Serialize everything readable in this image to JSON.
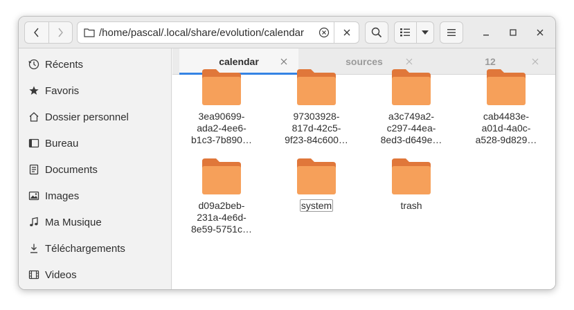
{
  "path": "/home/pascal/.local/share/evolution/calendar",
  "sidebar": {
    "items": [
      {
        "label": "Récents",
        "icon": "clock-icon"
      },
      {
        "label": "Favoris",
        "icon": "star-icon"
      },
      {
        "label": "Dossier personnel",
        "icon": "home-icon"
      },
      {
        "label": "Bureau",
        "icon": "desktop-icon"
      },
      {
        "label": "Documents",
        "icon": "document-icon"
      },
      {
        "label": "Images",
        "icon": "image-icon"
      },
      {
        "label": "Ma Musique",
        "icon": "music-icon"
      },
      {
        "label": "Téléchargements",
        "icon": "download-icon"
      },
      {
        "label": "Videos",
        "icon": "video-icon"
      }
    ]
  },
  "tabs": [
    {
      "label": "calendar",
      "active": true
    },
    {
      "label": "sources",
      "active": false
    },
    {
      "label": "12",
      "active": false
    }
  ],
  "files": [
    {
      "name_lines": [
        "3ea90699-",
        "ada2-4ee6-",
        "b1c3-7b890…"
      ]
    },
    {
      "name_lines": [
        "97303928-",
        "817d-42c5-",
        "9f23-84c600…"
      ]
    },
    {
      "name_lines": [
        "a3c749a2-",
        "c297-44ea-",
        "8ed3-d649e…"
      ]
    },
    {
      "name_lines": [
        "cab4483e-",
        "a01d-4a0c-",
        "a528-9d829…"
      ]
    },
    {
      "name_lines": [
        "d09a2beb-",
        "231a-4e6d-",
        "8e59-5751c…"
      ]
    },
    {
      "name_lines": [
        "system"
      ]
    },
    {
      "name_lines": [
        "trash"
      ]
    }
  ],
  "colors": {
    "folder_body": "#f6a05a",
    "folder_tab": "#e0773a",
    "accent": "#3584e4"
  }
}
